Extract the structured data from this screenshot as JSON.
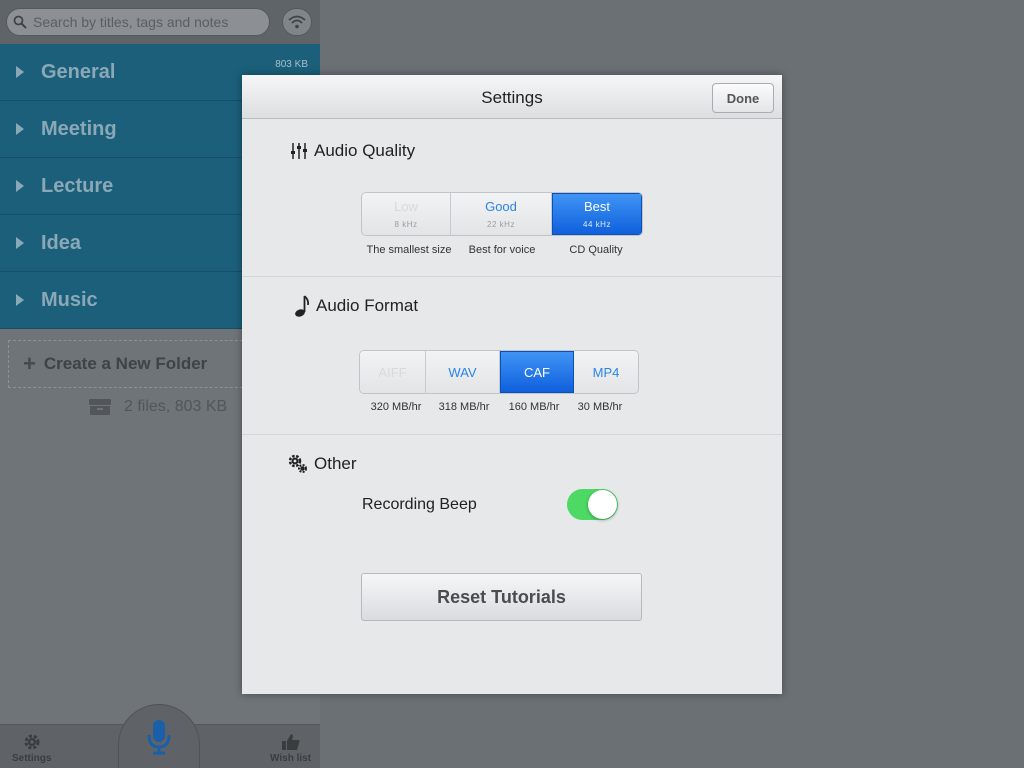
{
  "sidebar": {
    "search": {
      "placeholder": "Search by titles, tags and notes"
    },
    "folders": [
      {
        "name": "General",
        "size": "803 KB"
      },
      {
        "name": "Meeting"
      },
      {
        "name": "Lecture"
      },
      {
        "name": "Idea"
      },
      {
        "name": "Music"
      }
    ],
    "create_folder_label": "Create a New Folder",
    "files_summary": "2 files, 803 KB",
    "tabbar": {
      "settings_label": "Settings",
      "wishlist_label": "Wish list"
    }
  },
  "modal": {
    "title": "Settings",
    "done_label": "Done",
    "audio_quality": {
      "title": "Audio Quality",
      "options": [
        {
          "label": "Low",
          "sub": "8 kHz",
          "caption": "The smallest size",
          "state": "disabled"
        },
        {
          "label": "Good",
          "sub": "22 kHz",
          "caption": "Best for voice",
          "state": "normal"
        },
        {
          "label": "Best",
          "sub": "44 kHz",
          "caption": "CD Quality",
          "state": "selected"
        }
      ]
    },
    "audio_format": {
      "title": "Audio Format",
      "options": [
        {
          "label": "AIFF",
          "caption": "320 MB/hr",
          "state": "disabled"
        },
        {
          "label": "WAV",
          "caption": "318 MB/hr",
          "state": "normal"
        },
        {
          "label": "CAF",
          "caption": "160 MB/hr",
          "state": "selected"
        },
        {
          "label": "MP4",
          "caption": "30 MB/hr",
          "state": "normal"
        }
      ]
    },
    "other": {
      "title": "Other",
      "recording_beep_label": "Recording Beep",
      "recording_beep_on": true
    },
    "reset_label": "Reset Tutorials"
  },
  "colors": {
    "accent": "#2b84e8",
    "selected": "#0f60dc",
    "toggle_on": "#4cd964",
    "folder_bg": "#1b5f7b"
  }
}
